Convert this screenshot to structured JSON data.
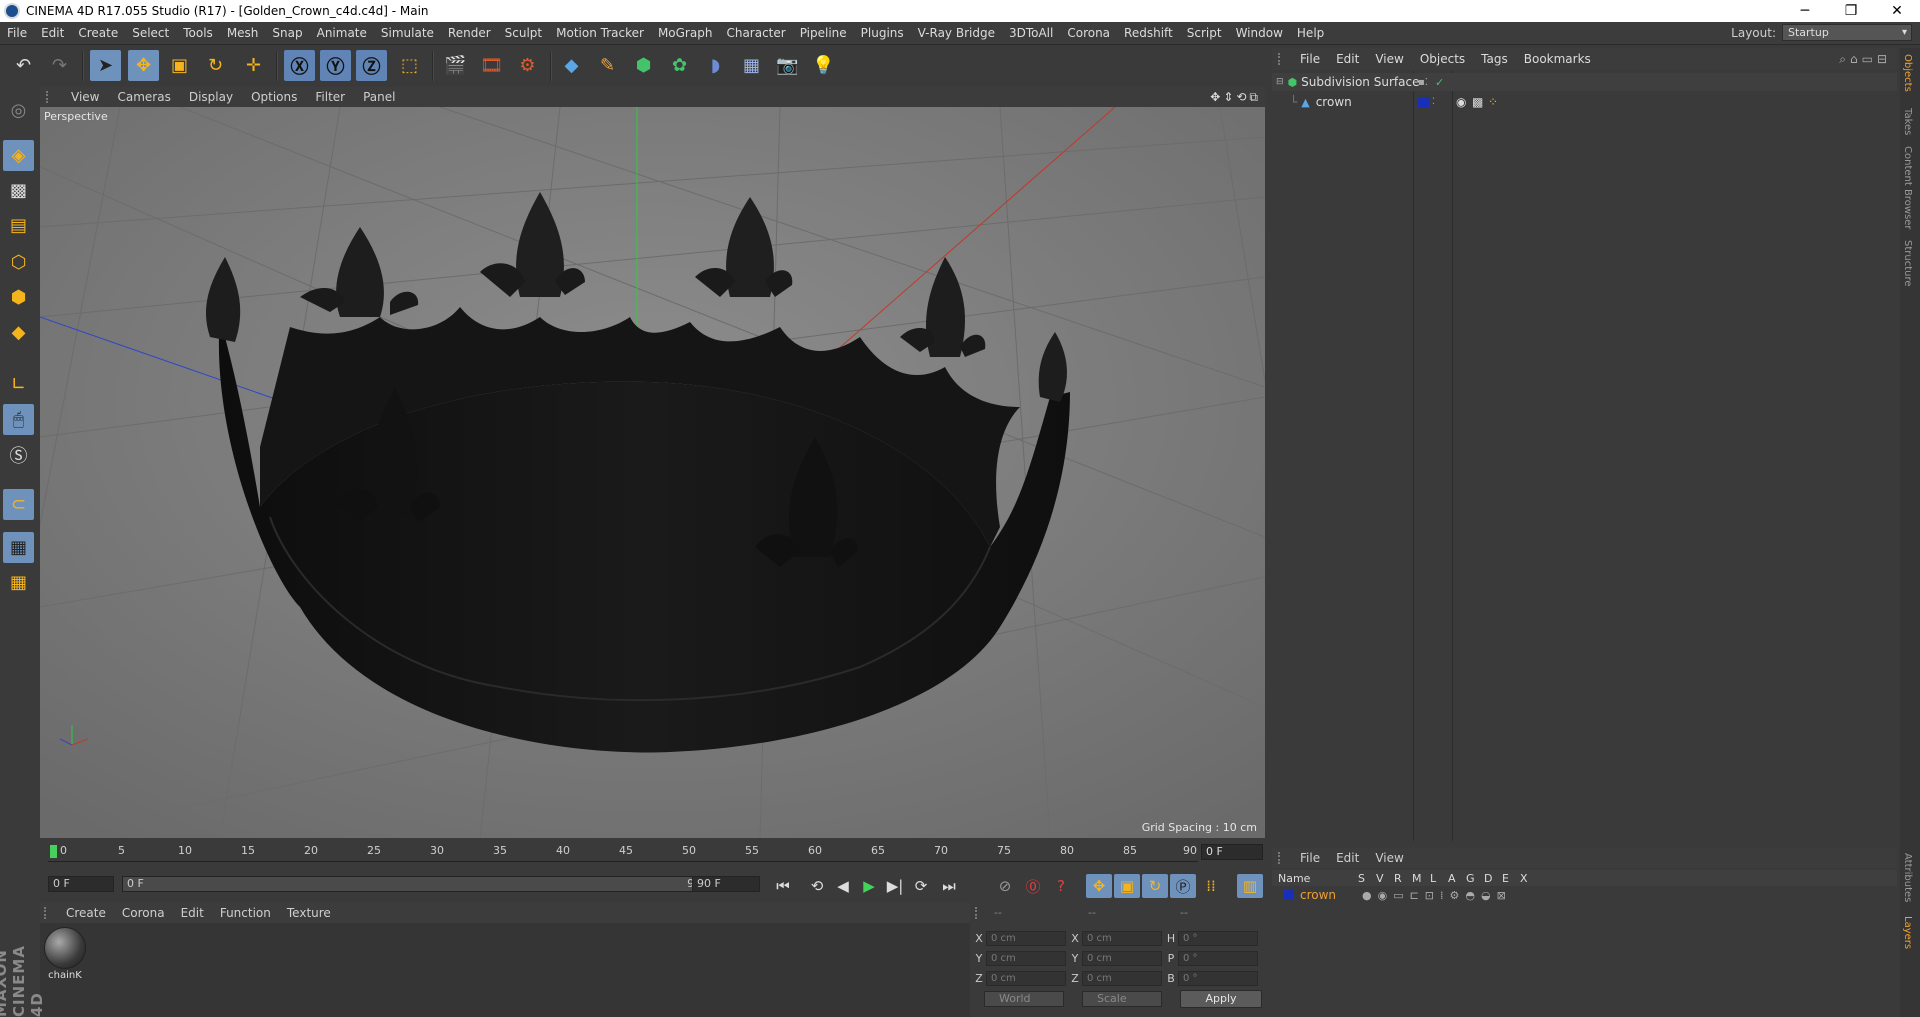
{
  "window": {
    "title": "CINEMA 4D R17.055 Studio (R17) - [Golden_Crown_c4d.c4d] - Main",
    "minimize": "─",
    "restore": "❐",
    "close": "✕"
  },
  "menubar": {
    "items": [
      "File",
      "Edit",
      "Create",
      "Select",
      "Tools",
      "Mesh",
      "Snap",
      "Animate",
      "Simulate",
      "Render",
      "Sculpt",
      "Motion Tracker",
      "MoGraph",
      "Character",
      "Pipeline",
      "Plugins",
      "V-Ray Bridge",
      "3DToAll",
      "Corona",
      "Redshift",
      "Script",
      "Window",
      "Help"
    ],
    "layout_label": "Layout:",
    "layout_value": "Startup"
  },
  "viewport": {
    "menu": [
      "View",
      "Cameras",
      "Display",
      "Options",
      "Filter",
      "Panel"
    ],
    "camera_label": "Perspective",
    "grid_spacing": "Grid Spacing : 10 cm"
  },
  "timeline": {
    "ticks": [
      "0",
      "5",
      "10",
      "15",
      "20",
      "25",
      "30",
      "35",
      "40",
      "45",
      "50",
      "55",
      "60",
      "65",
      "70",
      "75",
      "80",
      "85",
      "90"
    ],
    "current_frame": "0 F",
    "start_field": "0 F",
    "slider_start": "0 F",
    "slider_end": "90 F",
    "end_field": "90 F"
  },
  "materials": {
    "menu": [
      "Create",
      "Corona",
      "Edit",
      "Function",
      "Texture"
    ],
    "items": [
      {
        "name": "chainK"
      }
    ]
  },
  "coords": {
    "headers": [
      "--",
      "--",
      "--"
    ],
    "rows": [
      {
        "a": "X",
        "av": "0 cm",
        "b": "X",
        "bv": "0 cm",
        "c": "H",
        "cv": "0 °"
      },
      {
        "a": "Y",
        "av": "0 cm",
        "b": "Y",
        "bv": "0 cm",
        "c": "P",
        "cv": "0 °"
      },
      {
        "a": "Z",
        "av": "0 cm",
        "b": "Z",
        "bv": "0 cm",
        "c": "B",
        "cv": "0 °"
      }
    ],
    "mode1": "World",
    "mode2": "Scale",
    "apply": "Apply"
  },
  "object_manager": {
    "menu": [
      "File",
      "Edit",
      "View",
      "Objects",
      "Tags",
      "Bookmarks"
    ],
    "objects": [
      {
        "name": "Subdivision Surface"
      },
      {
        "name": "crown"
      }
    ]
  },
  "layer_manager": {
    "menu": [
      "File",
      "Edit",
      "View"
    ],
    "columns": [
      "Name",
      "S",
      "V",
      "R",
      "M",
      "L",
      "A",
      "G",
      "D",
      "E",
      "X"
    ],
    "layers": [
      {
        "name": "crown",
        "color": "#1a2fb8"
      }
    ]
  },
  "side_tabs": [
    "Objects",
    "Takes",
    "Content Browser",
    "Structure"
  ],
  "side_tabs_bottom": [
    "Attributes",
    "Layers"
  ],
  "branding": "MAXON CINEMA 4D",
  "colors": {
    "accent_blue": "#6f92bd",
    "x_axis": "#c0392b",
    "y_axis": "#2ecc40",
    "z_axis": "#3346c6",
    "layer_name": "#f0a030"
  }
}
